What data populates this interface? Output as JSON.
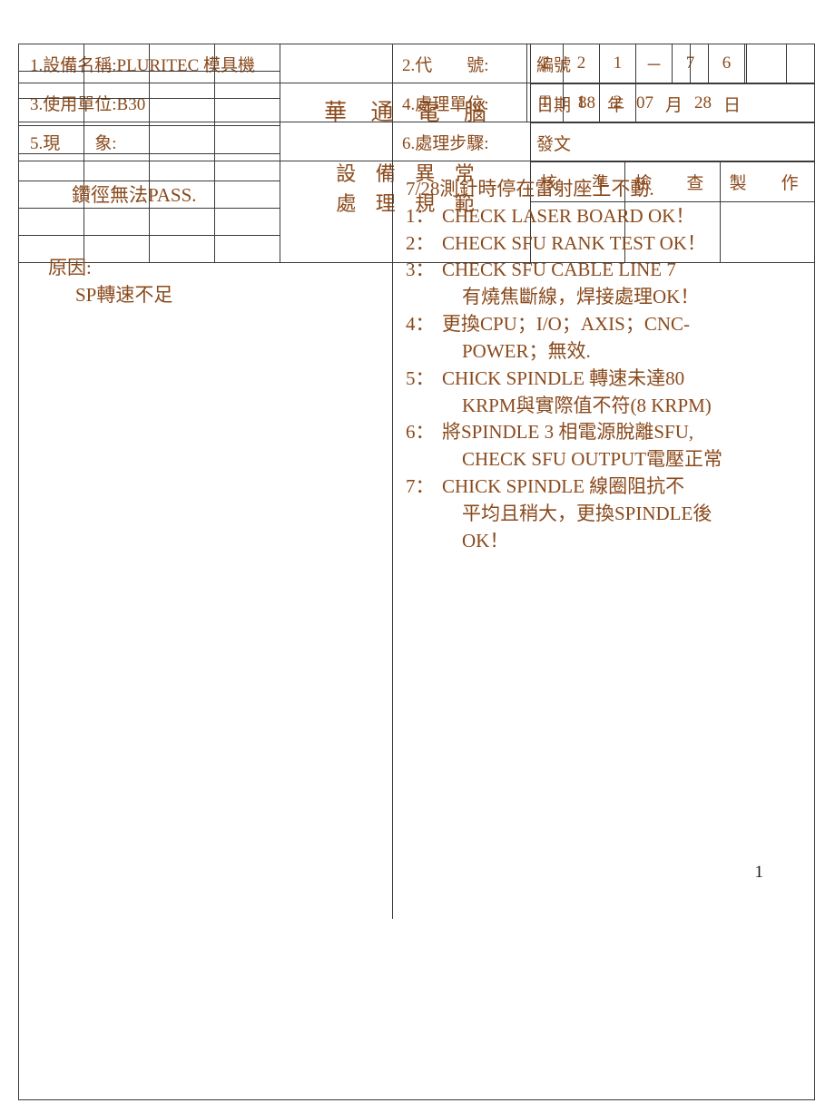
{
  "document": {
    "title_main": "華 通 電 腦",
    "title_sub_line1": "設 備 異 常",
    "title_sub_line2": "處 理 規 範",
    "page_number": "1"
  },
  "meta": {
    "number_label": "編號",
    "number_value": "",
    "number_extra_a": "",
    "number_extra_b": "",
    "date": {
      "label": "日期",
      "year_value": "88",
      "year_unit": "年",
      "month_value": "07",
      "month_unit": "月",
      "day_value": "28",
      "day_unit": "日"
    },
    "issue_label": "發文",
    "issue_value": "",
    "signature_headers": [
      "核　　準",
      "檢　　查",
      "製　　作"
    ],
    "signature_values": [
      "",
      "",
      ""
    ]
  },
  "fields": {
    "equipment_name": "1.設備名稱:PLURITEC 模具機",
    "code_label": "2.代　　號:",
    "code_cells": [
      "2",
      "2",
      "1",
      "－",
      "7",
      "6",
      "",
      ""
    ],
    "using_unit": "3.使用單位:B30",
    "handling_unit_label": "4.處理單位:",
    "handling_unit_cells": [
      "T",
      "1",
      "2",
      ""
    ],
    "symptom_label": "5.現　　象:",
    "steps_label": "6.處理步驟:"
  },
  "symptom": {
    "line1": "鑽徑無法PASS.",
    "cause_label": "原因:",
    "cause_value": "SP轉速不足"
  },
  "steps": {
    "intro": "7/28測針時停在雷射座上不動.",
    "items": [
      {
        "num": "1：",
        "text": "CHECK LASER BOARD OK！",
        "cont": ""
      },
      {
        "num": "2：",
        "text": "CHECK SFU RANK TEST OK！",
        "cont": ""
      },
      {
        "num": "3：",
        "text": "CHECK SFU CABLE LINE 7",
        "cont": "有燒焦斷線，焊接處理OK！"
      },
      {
        "num": "4：",
        "text": "更換CPU；I/O；AXIS；CNC-",
        "cont": "POWER；無效."
      },
      {
        "num": "5：",
        "text": "CHICK SPINDLE 轉速未達80",
        "cont": "KRPM與實際值不符(8 KRPM)"
      },
      {
        "num": "6：",
        "text": "將SPINDLE 3 相電源脫離SFU,",
        "cont": "CHECK SFU OUTPUT電壓正常"
      },
      {
        "num": "7：",
        "text": "CHICK SPINDLE 線圈阻抗不",
        "cont": "平均且稍大，更換SPINDLE後",
        "cont2": "OK！"
      }
    ]
  },
  "colors": {
    "text": "#8a4a1c",
    "border": "#3a3a3a",
    "page_number": "#1a1a1a",
    "background": "#ffffff"
  }
}
